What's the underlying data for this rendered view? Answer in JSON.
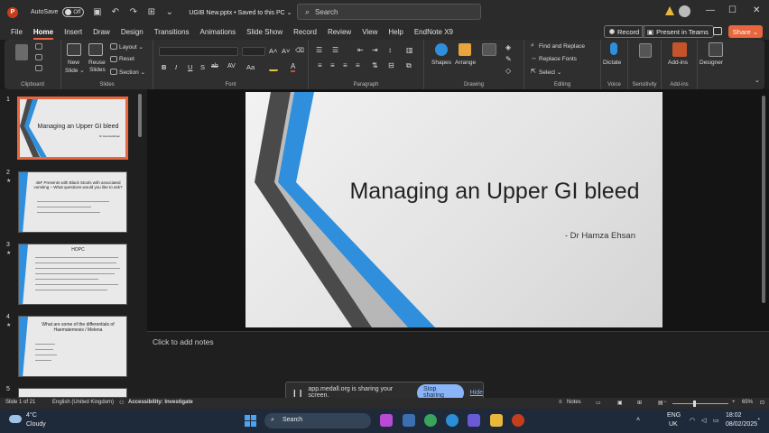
{
  "titlebar": {
    "autosave_label": "AutoSave",
    "autosave_state": "Off",
    "doc_title": "UGIB New.pptx • Saved to this PC ⌄",
    "search_placeholder": "Search",
    "minimize": "—",
    "maximize": "☐",
    "close": "✕"
  },
  "menu": {
    "tabs": [
      "File",
      "Home",
      "Insert",
      "Draw",
      "Design",
      "Transitions",
      "Animations",
      "Slide Show",
      "Record",
      "Review",
      "View",
      "Help",
      "EndNote X9"
    ],
    "active_tab": "Home",
    "record_label": "Record",
    "present_teams_label": "Present in Teams",
    "share_label": "Share ⌄"
  },
  "ribbon": {
    "groups": {
      "clipboard": "Clipboard",
      "slides": "Slides",
      "font": "Font",
      "paragraph": "Paragraph",
      "drawing": "Drawing",
      "editing": "Editing",
      "voice": "Voice",
      "sensitivity": "Sensitivity",
      "addins": "Add-ins"
    },
    "new_slide": "New",
    "new_slide_2": "Slide ⌄",
    "reuse_slides": "Reuse",
    "reuse_slides_2": "Slides",
    "layout": "Layout ⌄",
    "reset": "Reset",
    "section": "Section ⌄",
    "shapes": "Shapes",
    "arrange": "Arrange",
    "find_replace": "Find and Replace",
    "replace_fonts": "Replace Fonts",
    "select": "Select ⌄",
    "dictate": "Dictate",
    "addins_btn": "Add-ins",
    "designer": "Designer",
    "font_letters": [
      "B",
      "I",
      "U",
      "S",
      "ab",
      "AV",
      "Aa",
      "A"
    ]
  },
  "thumbnails": [
    {
      "number": "1",
      "title": "Managing an Upper GI bleed",
      "subtitle": "Dr Hamza Ehsan",
      "selected": true
    },
    {
      "number": "2",
      "title": "45F Presents with Black Stools with associated vomiting – What questions would you like to ask?",
      "selected": false
    },
    {
      "number": "3",
      "title": "HOPC",
      "selected": false
    },
    {
      "number": "4",
      "title": "What are some of the differentials of Haematemesis / Melena",
      "selected": false
    },
    {
      "number": "5"
    }
  ],
  "slide": {
    "title": "Managing an Upper GI bleed",
    "subtitle": "- Dr Hamza Ehsan"
  },
  "notes": {
    "placeholder": "Click to add notes"
  },
  "sharing": {
    "message": "app.medall.org is sharing your screen.",
    "stop_label": "Stop sharing",
    "hide_label": "Hide"
  },
  "status": {
    "slide_count": "Slide 1 of 21",
    "language": "English (United Kingdom)",
    "accessibility": "Accessibility: Investigate",
    "notes_label": "Notes",
    "zoom": "65%"
  },
  "taskbar": {
    "temperature": "4°C",
    "weather": "Cloudy",
    "search_label": "Search",
    "lang_1": "ENG",
    "lang_2": "UK",
    "time": "18:02",
    "date": "08/02/2025"
  },
  "colors": {
    "accent": "#e8663d",
    "slide_blue": "#2f8fdc",
    "slide_dark": "#4a4a4a"
  }
}
